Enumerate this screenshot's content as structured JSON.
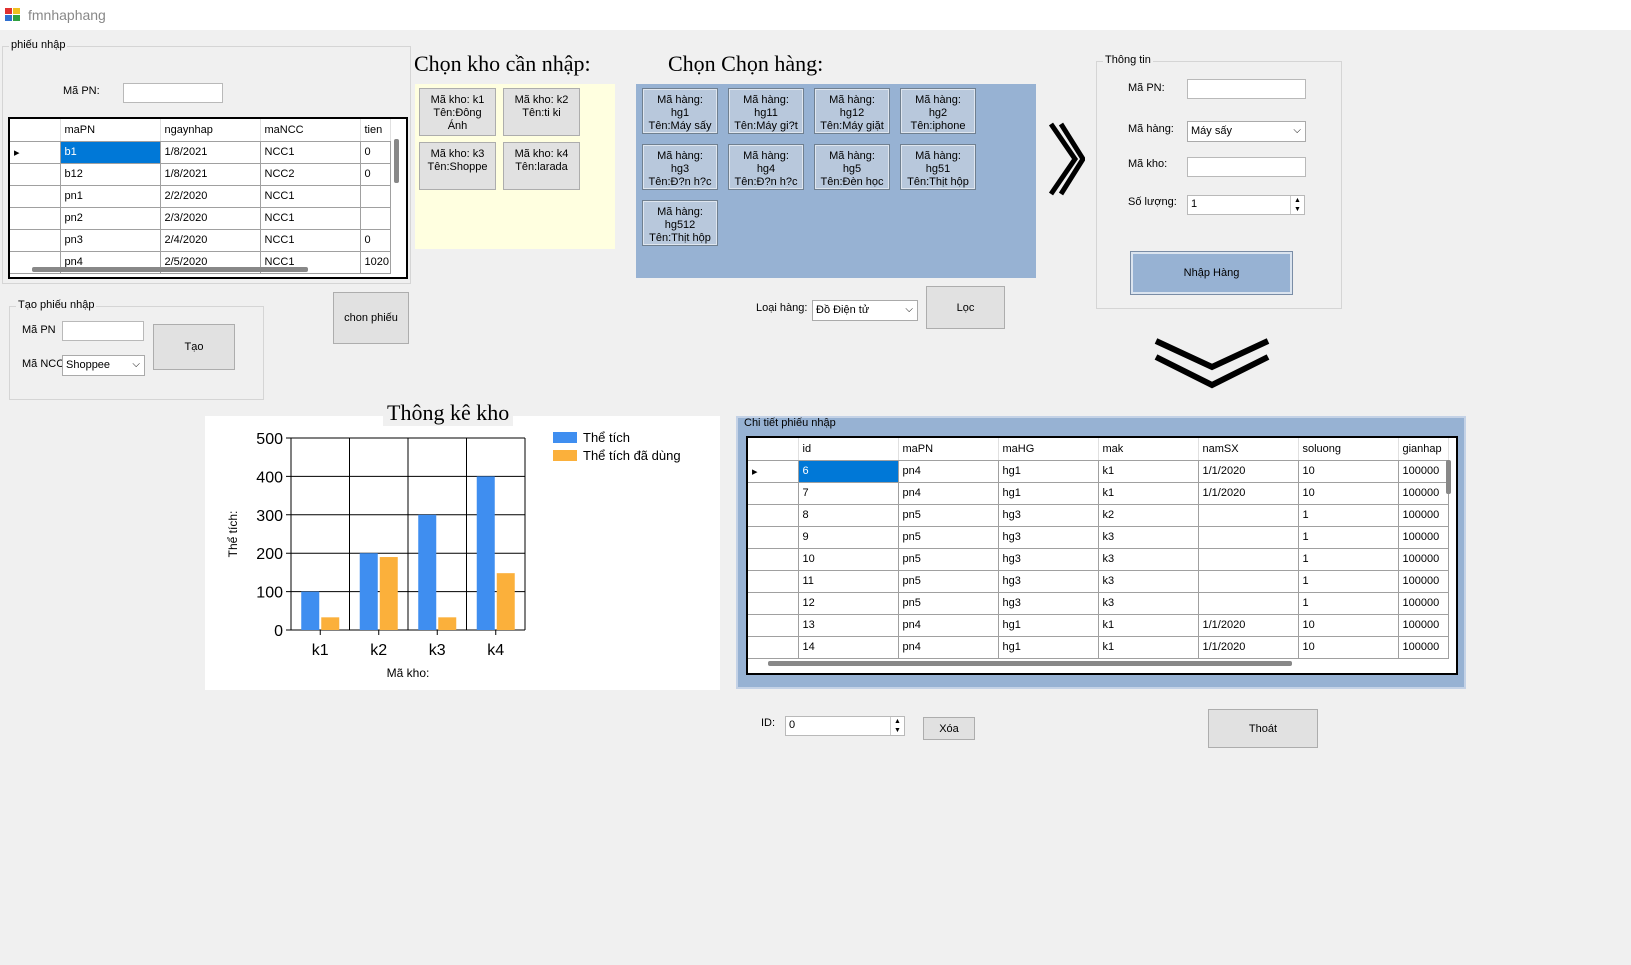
{
  "window": {
    "title": "fmnhaphang"
  },
  "phieu_nhap": {
    "group_label": "phiếu nhập",
    "ma_pn_label": "Mã PN:",
    "ma_pn_value": "",
    "columns": [
      "maPN",
      "ngaynhap",
      "maNCC",
      "tien"
    ],
    "rows": [
      [
        "b1",
        "1/8/2021",
        "NCC1",
        "0"
      ],
      [
        "b12",
        "1/8/2021",
        "NCC2",
        "0"
      ],
      [
        "pn1",
        "2/2/2020",
        "NCC1",
        ""
      ],
      [
        "pn2",
        "2/3/2020",
        "NCC1",
        ""
      ],
      [
        "pn3",
        "2/4/2020",
        "NCC1",
        "0"
      ],
      [
        "pn4",
        "2/5/2020",
        "NCC1",
        "1020"
      ]
    ]
  },
  "tao_phieu": {
    "group_label": "Tạo phiếu nhập",
    "ma_pn_label": "Mã PN",
    "ma_pn_value": "",
    "ma_ncc_label": "Mã NCC",
    "ma_ncc_value": "Shoppee",
    "tao_button": "Tạo",
    "chon_phieu_button": "chon phiếu"
  },
  "kho": {
    "heading": "Chọn kho cần nhập:",
    "items": [
      {
        "line1": "Mã kho: k1",
        "line2": "Tên:Đông",
        "line3": "Ánh"
      },
      {
        "line1": "Mã kho: k2",
        "line2": "Tên:ti ki",
        "line3": ""
      },
      {
        "line1": "Mã kho: k3",
        "line2": "Tên:Shoppe",
        "line3": ""
      },
      {
        "line1": "Mã kho: k4",
        "line2": "Tên:larada",
        "line3": ""
      }
    ]
  },
  "hang": {
    "heading": "Chọn Chọn hàng:",
    "items": [
      {
        "line1": "Mã hàng:",
        "line2": "hg1",
        "line3": "Tên:Máy sấy"
      },
      {
        "line1": "Mã hàng:",
        "line2": "hg11",
        "line3": "Tên:Máy gi?t"
      },
      {
        "line1": "Mã hàng:",
        "line2": "hg12",
        "line3": "Tên:Máy giặt"
      },
      {
        "line1": "Mã hàng:",
        "line2": "hg2",
        "line3": "Tên:iphone"
      },
      {
        "line1": "Mã hàng:",
        "line2": "hg3",
        "line3": "Tên:Đ?n h?c"
      },
      {
        "line1": "Mã hàng:",
        "line2": "hg4",
        "line3": "Tên:Đ?n h?c"
      },
      {
        "line1": "Mã hàng:",
        "line2": "hg5",
        "line3": "Tên:Đèn học"
      },
      {
        "line1": "Mã hàng:",
        "line2": "hg51",
        "line3": "Tên:Thịt hộp"
      },
      {
        "line1": "Mã hàng:",
        "line2": "hg512",
        "line3": "Tên:Thịt hộp"
      }
    ],
    "loai_label": "Loại hàng:",
    "loai_value": "Đồ Điện tử",
    "loc_button": "Lọc"
  },
  "thong_tin": {
    "group_label": "Thông tin",
    "ma_pn_label": "Mã PN:",
    "ma_pn_value": "",
    "ma_hang_label": "Mã hàng:",
    "ma_hang_value": "Máy sấy",
    "ma_kho_label": "Mã kho:",
    "ma_kho_value": "",
    "so_luong_label": "Số lượng:",
    "so_luong_value": "1",
    "nhap_button": "Nhập Hàng"
  },
  "thong_ke": {
    "title": "Thông kê kho"
  },
  "chart_data": {
    "type": "bar",
    "title": "Thông kê kho",
    "categories": [
      "k1",
      "k2",
      "k3",
      "k4"
    ],
    "series": [
      {
        "name": "Thể tích",
        "values": [
          100,
          200,
          300,
          400
        ],
        "color": "#3f8ef0"
      },
      {
        "name": "Thể tích đã dùng",
        "values": [
          33,
          190,
          33,
          148
        ],
        "color": "#fbb03b"
      }
    ],
    "xlabel": "Mã kho:",
    "ylabel": "Thể tích:",
    "ylim": [
      0,
      500
    ],
    "yticks": [
      0,
      100,
      200,
      300,
      400,
      500
    ],
    "grid": true,
    "legend": "top-right"
  },
  "chi_tiet": {
    "group_label": "Chi tiết phiếu nhập",
    "columns": [
      "id",
      "maPN",
      "maHG",
      "mak",
      "namSX",
      "soluong",
      "gianhap"
    ],
    "rows": [
      [
        "6",
        "pn4",
        "hg1",
        "k1",
        "1/1/2020",
        "10",
        "100000"
      ],
      [
        "7",
        "pn4",
        "hg1",
        "k1",
        "1/1/2020",
        "10",
        "100000"
      ],
      [
        "8",
        "pn5",
        "hg3",
        "k2",
        "",
        "1",
        "100000"
      ],
      [
        "9",
        "pn5",
        "hg3",
        "k3",
        "",
        "1",
        "100000"
      ],
      [
        "10",
        "pn5",
        "hg3",
        "k3",
        "",
        "1",
        "100000"
      ],
      [
        "11",
        "pn5",
        "hg3",
        "k3",
        "",
        "1",
        "100000"
      ],
      [
        "12",
        "pn5",
        "hg3",
        "k3",
        "",
        "1",
        "100000"
      ],
      [
        "13",
        "pn4",
        "hg1",
        "k1",
        "1/1/2020",
        "10",
        "100000"
      ],
      [
        "14",
        "pn4",
        "hg1",
        "k1",
        "1/1/2020",
        "10",
        "100000"
      ]
    ]
  },
  "footer": {
    "id_label": "ID:",
    "id_value": "0",
    "xoa_button": "Xóa",
    "thoat_button": "Thoát"
  }
}
